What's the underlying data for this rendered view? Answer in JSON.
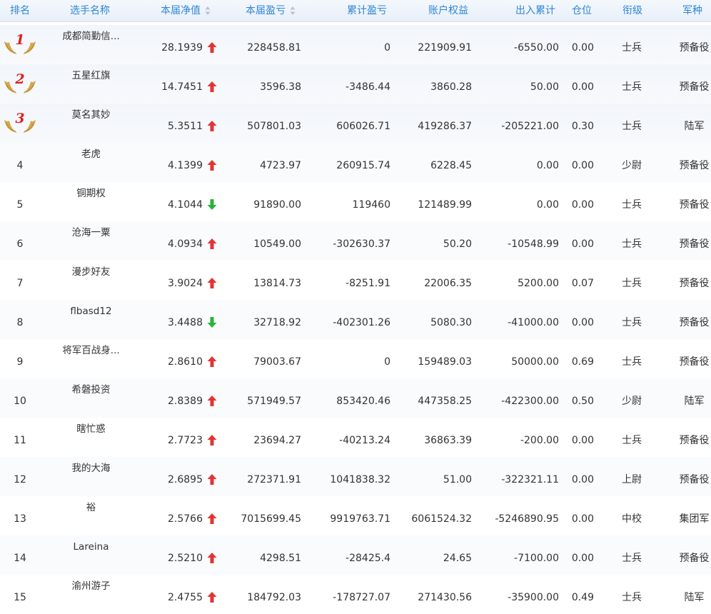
{
  "header": {
    "rank": "排名",
    "name": "选手名称",
    "nav": "本届净值",
    "pl": "本届盈亏",
    "cum_pl": "累计盈亏",
    "equity": "账户权益",
    "flow": "出入累计",
    "position": "仓位",
    "title": "衔级",
    "arm": "军种"
  },
  "colors": {
    "header_text": "#2f86d6",
    "up": "#e53333",
    "down": "#2ab33a",
    "badge_number": "#e02020",
    "wing": "#d6a64a"
  },
  "rows": [
    {
      "rank": "1",
      "name": "成都简勤信...",
      "nav": "28.1939",
      "trend": "up",
      "pl": "228458.81",
      "cum_pl": "0",
      "equity": "221909.91",
      "flow": "-6550.00",
      "position": "0.00",
      "title": "士兵",
      "arm": "预备役"
    },
    {
      "rank": "2",
      "name": "五星红旗",
      "nav": "14.7451",
      "trend": "up",
      "pl": "3596.38",
      "cum_pl": "-3486.44",
      "equity": "3860.28",
      "flow": "50.00",
      "position": "0.00",
      "title": "士兵",
      "arm": "预备役"
    },
    {
      "rank": "3",
      "name": "莫名其妙",
      "nav": "5.3511",
      "trend": "up",
      "pl": "507801.03",
      "cum_pl": "606026.71",
      "equity": "419286.37",
      "flow": "-205221.00",
      "position": "0.30",
      "title": "士兵",
      "arm": "陆军"
    },
    {
      "rank": "4",
      "name": "老虎",
      "nav": "4.1399",
      "trend": "up",
      "pl": "4723.97",
      "cum_pl": "260915.74",
      "equity": "6228.45",
      "flow": "0.00",
      "position": "0.00",
      "title": "少尉",
      "arm": "预备役"
    },
    {
      "rank": "5",
      "name": "铜期权",
      "nav": "4.1044",
      "trend": "down",
      "pl": "91890.00",
      "cum_pl": "119460",
      "equity": "121489.99",
      "flow": "0.00",
      "position": "0.00",
      "title": "士兵",
      "arm": "预备役"
    },
    {
      "rank": "6",
      "name": "沧海一粟",
      "nav": "4.0934",
      "trend": "up",
      "pl": "10549.00",
      "cum_pl": "-302630.37",
      "equity": "50.20",
      "flow": "-10548.99",
      "position": "0.00",
      "title": "士兵",
      "arm": "预备役"
    },
    {
      "rank": "7",
      "name": "漫步好友",
      "nav": "3.9024",
      "trend": "up",
      "pl": "13814.73",
      "cum_pl": "-8251.91",
      "equity": "22006.35",
      "flow": "5200.00",
      "position": "0.07",
      "title": "士兵",
      "arm": "预备役"
    },
    {
      "rank": "8",
      "name": "flbasd12",
      "nav": "3.4488",
      "trend": "down",
      "pl": "32718.92",
      "cum_pl": "-402301.26",
      "equity": "5080.30",
      "flow": "-41000.00",
      "position": "0.00",
      "title": "士兵",
      "arm": "预备役"
    },
    {
      "rank": "9",
      "name": "将军百战身...",
      "nav": "2.8610",
      "trend": "up",
      "pl": "79003.67",
      "cum_pl": "0",
      "equity": "159489.03",
      "flow": "50000.00",
      "position": "0.69",
      "title": "士兵",
      "arm": "预备役"
    },
    {
      "rank": "10",
      "name": "希磐投资",
      "nav": "2.8389",
      "trend": "up",
      "pl": "571949.57",
      "cum_pl": "853420.46",
      "equity": "447358.25",
      "flow": "-422300.00",
      "position": "0.50",
      "title": "少尉",
      "arm": "陆军"
    },
    {
      "rank": "11",
      "name": "瞎忙惑",
      "nav": "2.7723",
      "trend": "up",
      "pl": "23694.27",
      "cum_pl": "-40213.24",
      "equity": "36863.39",
      "flow": "-200.00",
      "position": "0.00",
      "title": "士兵",
      "arm": "预备役"
    },
    {
      "rank": "12",
      "name": "我的大海",
      "nav": "2.6895",
      "trend": "up",
      "pl": "272371.91",
      "cum_pl": "1041838.32",
      "equity": "51.00",
      "flow": "-322321.11",
      "position": "0.00",
      "title": "上尉",
      "arm": "预备役"
    },
    {
      "rank": "13",
      "name": "裕",
      "nav": "2.5766",
      "trend": "up",
      "pl": "7015699.45",
      "cum_pl": "9919763.71",
      "equity": "6061524.32",
      "flow": "-5246890.95",
      "position": "0.00",
      "title": "中校",
      "arm": "集团军"
    },
    {
      "rank": "14",
      "name": "Lareina",
      "nav": "2.5210",
      "trend": "up",
      "pl": "4298.51",
      "cum_pl": "-28425.4",
      "equity": "24.65",
      "flow": "-7100.00",
      "position": "0.00",
      "title": "士兵",
      "arm": "预备役"
    },
    {
      "rank": "15",
      "name": "渝州游子",
      "nav": "2.4755",
      "trend": "up",
      "pl": "184792.03",
      "cum_pl": "-178727.07",
      "equity": "271430.56",
      "flow": "-35900.00",
      "position": "0.49",
      "title": "士兵",
      "arm": "陆军"
    }
  ]
}
